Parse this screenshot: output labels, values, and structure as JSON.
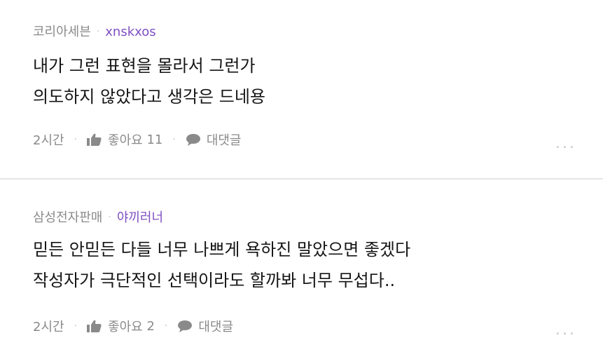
{
  "comments": [
    {
      "group": "코리아세븐",
      "author": "xnskxos",
      "lines": [
        "내가 그런 표현을 몰라서 그런가",
        "의도하지 않았다고 생각은 드네용"
      ],
      "time": "2시간",
      "like_label": "좋아요",
      "like_count": "11",
      "reply_label": "대댓글",
      "more_label": "..."
    },
    {
      "group": "삼성전자판매",
      "author": "야끼러너",
      "lines": [
        "믿든 안믿든 다들 너무 나쁘게 욕하진 말았으면 좋겠다",
        "작성자가 극단적인 선택이라도 할까봐 너무 무섭다.."
      ],
      "time": "2시간",
      "like_label": "좋아요",
      "like_count": "2",
      "reply_label": "대댓글",
      "more_label": "..."
    }
  ],
  "separator_glyph": "·",
  "icons": {
    "like": "thumbs-up-icon",
    "reply": "speech-bubble-icon",
    "more": "more-options-icon"
  },
  "colors": {
    "author": "#7f4fc2",
    "meta": "#8a8a8a",
    "text": "#151515",
    "divider": "#e6e6e6"
  }
}
